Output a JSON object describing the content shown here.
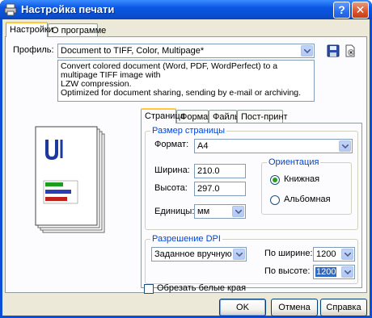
{
  "window": {
    "title": "Настройка печати"
  },
  "top_tabs": [
    "Настройки",
    "О программе"
  ],
  "profile": {
    "label": "Профиль:",
    "value": "Document to TIFF, Color, Multipage*",
    "description": [
      "Convert colored document (Word, PDF, WordPerfect) to a multipage TIFF image with",
      "LZW compression.",
      "Optimized for document sharing, sending by e-mail or archiving."
    ],
    "save_icon": "floppy-disk-icon",
    "delete_icon": "document-delete-icon"
  },
  "inner_tabs": [
    "Страница",
    "Формат",
    "Файлы",
    "Пост-принт"
  ],
  "page_size": {
    "group_title": "Размер страницы",
    "format_label": "Формат:",
    "format_value": "A4",
    "width_label": "Ширина:",
    "width_value": "210.0",
    "height_label": "Высота:",
    "height_value": "297.0",
    "units_label": "Единицы:",
    "units_value": "мм"
  },
  "orientation": {
    "group_title": "Ориентация",
    "portrait": "Книжная",
    "landscape": "Альбомная",
    "selected": "portrait"
  },
  "dpi": {
    "group_title": "Разрешение DPI",
    "mode_value": "Заданное вручную",
    "width_label": "По ширине:",
    "width_value": "1200",
    "height_label": "По высоте:",
    "height_value": "1200"
  },
  "crop": {
    "label": "Обрезать белые края",
    "checked": false
  },
  "buttons": {
    "ok": "OK",
    "cancel": "Отмена",
    "help": "Справка"
  },
  "colors": {
    "title_bar": "#0a56e4",
    "accent_text": "#0046d5",
    "preview_bars": [
      "#1e9c1e",
      "#2a3fb5",
      "#c0201a"
    ]
  }
}
